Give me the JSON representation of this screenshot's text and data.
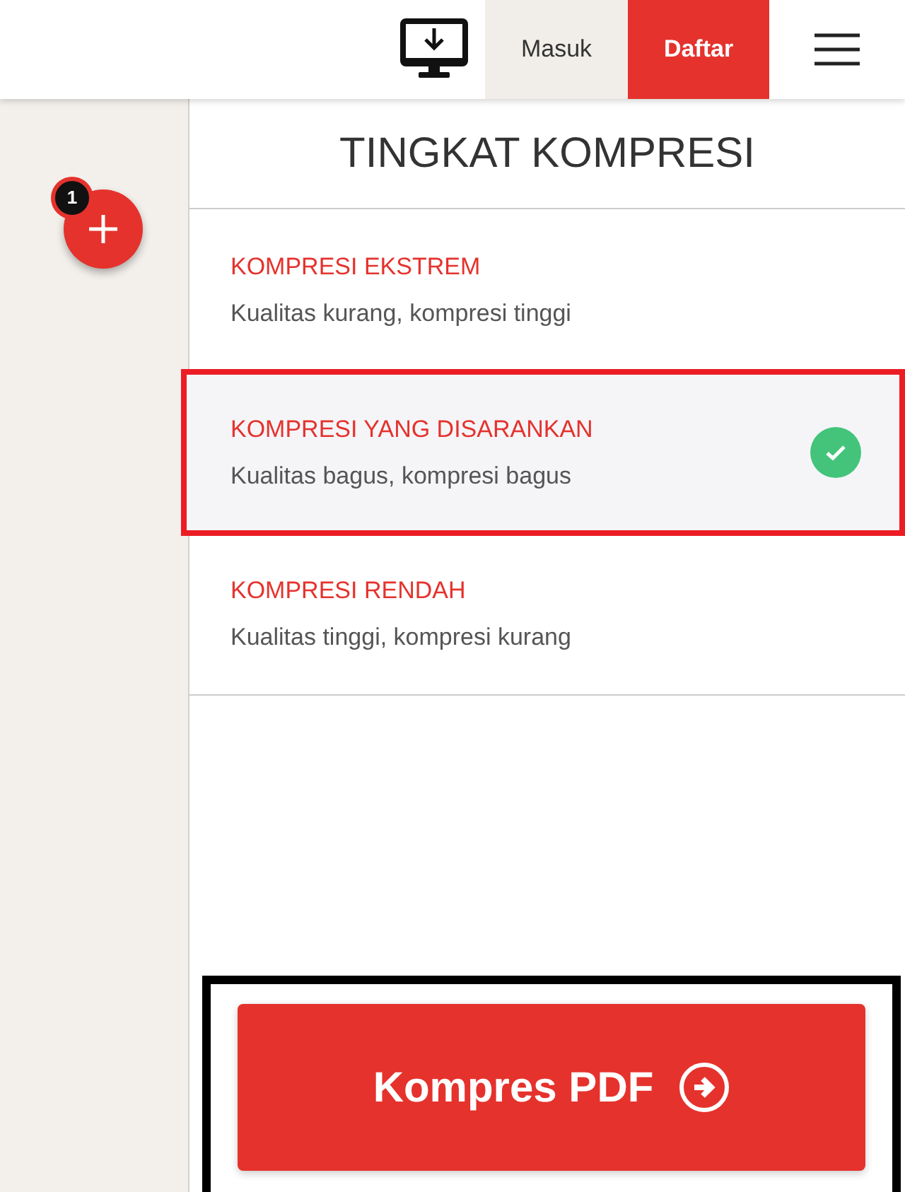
{
  "header": {
    "login": "Masuk",
    "signup": "Daftar"
  },
  "sidebar": {
    "file_count": "1"
  },
  "panel": {
    "title": "TINGKAT KOMPRESI",
    "options": [
      {
        "title": "KOMPRESI EKSTREM",
        "description": "Kualitas kurang, kompresi tinggi",
        "selected": false
      },
      {
        "title": "KOMPRESI YANG DISARANKAN",
        "description": "Kualitas bagus, kompresi bagus",
        "selected": true
      },
      {
        "title": "KOMPRESI RENDAH",
        "description": "Kualitas tinggi, kompresi kurang",
        "selected": false
      }
    ],
    "action": "Kompres PDF"
  }
}
